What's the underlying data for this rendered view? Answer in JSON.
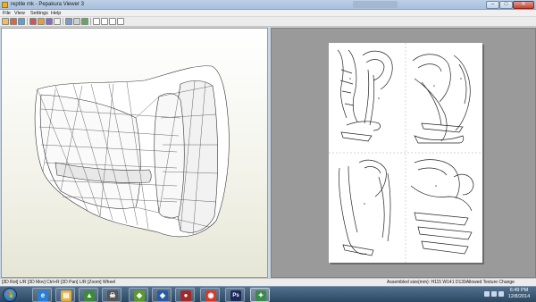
{
  "window": {
    "title": "reptile mk - Pepakura Viewer 3",
    "controls": {
      "minimize": "–",
      "maximize": "□",
      "close": "✕"
    }
  },
  "menu": [
    "File",
    "View",
    "Settings",
    "Help"
  ],
  "toolbar": {
    "icons": [
      "open-file",
      "save-file",
      "print",
      "view-3d",
      "view-2d",
      "texture",
      "zoom-in",
      "zoom-out",
      "settings",
      "help",
      "layout-1",
      "layout-2",
      "layout-3",
      "layout-4"
    ]
  },
  "status": {
    "left": "[3D Rot] L/R [3D Mov] Ctrl+R [2D Pan] L/R [Zoom] Wheel",
    "right": "Assembled size(mm): H115 W141 D139Allowed Texture Change"
  },
  "taskbar": {
    "apps": [
      {
        "name": "internet-explorer",
        "glyph": "e",
        "color": "#2a7fd4"
      },
      {
        "name": "file-explorer",
        "glyph": "▤",
        "color": "#e0b040"
      },
      {
        "name": "app-green",
        "glyph": "▲",
        "color": "#3c8a3c"
      },
      {
        "name": "app-skull",
        "glyph": "☠",
        "color": "#555555"
      },
      {
        "name": "app-games",
        "glyph": "◆",
        "color": "#5a9a2a"
      },
      {
        "name": "app-blue",
        "glyph": "◈",
        "color": "#2a5aa0"
      },
      {
        "name": "app-red",
        "glyph": "●",
        "color": "#a02a2a"
      },
      {
        "name": "chrome",
        "glyph": "◉",
        "color": "#d83a2a"
      },
      {
        "name": "photoshop",
        "glyph": "Ps",
        "color": "#1a2a5a"
      },
      {
        "name": "pepakura",
        "glyph": "✦",
        "color": "#3a8a4a"
      }
    ],
    "clock": {
      "time": "6:49 PM",
      "date": "12/8/2014"
    }
  },
  "colors": {
    "accent": "#3a5f80",
    "titlebar": "#a8c0dc",
    "close": "#c4453a"
  }
}
